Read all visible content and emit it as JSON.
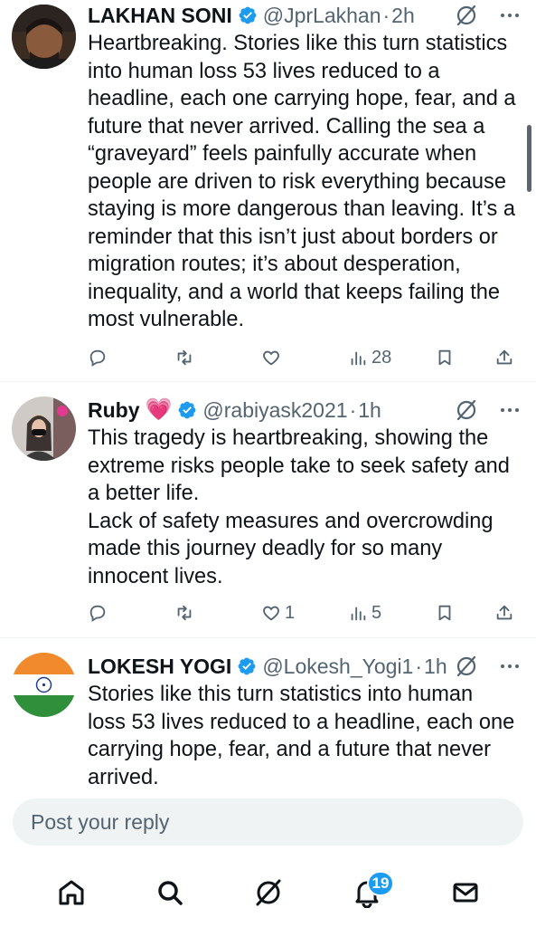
{
  "tweets": [
    {
      "name": "LAKHAN SONI",
      "handle": "@JprLakhan",
      "separator": "·",
      "time": "2h",
      "text": "Heartbreaking. Stories like this turn statistics\ninto human loss 53 lives reduced to a\nheadline, each one carrying hope, fear, and a\nfuture that never arrived. Calling the sea a\n“graveyard” feels painfully accurate when\npeople are driven to risk everything because\nstaying is more dangerous than leaving. It’s a\nreminder that this isn’t just about borders or\nmigration routes; it’s about desperation,\ninequality, and a world that keeps failing the\nmost vulnerable.",
      "likes": "",
      "views": "28"
    },
    {
      "name": "Ruby",
      "name_emoji": "💗",
      "handle": "@rabiyask2021",
      "separator": "·",
      "time": "1h",
      "text": "This tragedy is heartbreaking, showing the\nextreme risks people take to seek safety and\na better life.\nLack of safety measures and overcrowding\nmade this journey deadly for so many\ninnocent lives.",
      "likes": "1",
      "views": "5"
    },
    {
      "name": "LOKESH YOGI",
      "handle": "@Lokesh_Yogi1",
      "separator": "·",
      "time": "1h",
      "text": "Stories like this turn statistics into human\nloss 53 lives reduced to a headline, each one\ncarrying hope, fear, and a future that never\narrived.",
      "likes": "",
      "views": ""
    }
  ],
  "reply": {
    "placeholder": "Post your reply"
  },
  "nav": {
    "notifications_badge": "19"
  },
  "icons": {
    "reply": "reply-icon",
    "retweet": "retweet-icon",
    "like": "heart-icon",
    "views": "views-icon",
    "bookmark": "bookmark-icon",
    "share": "share-icon",
    "grok": "grok-icon",
    "more": "more-icon",
    "verified": "verified-badge-icon",
    "home": "home-icon",
    "search": "search-icon",
    "notifications": "bell-icon",
    "messages": "mail-icon"
  },
  "colors": {
    "accent": "#1d9bf0",
    "muted": "#536471",
    "text": "#0f1419",
    "heart_emoji": "#f03ab5"
  }
}
